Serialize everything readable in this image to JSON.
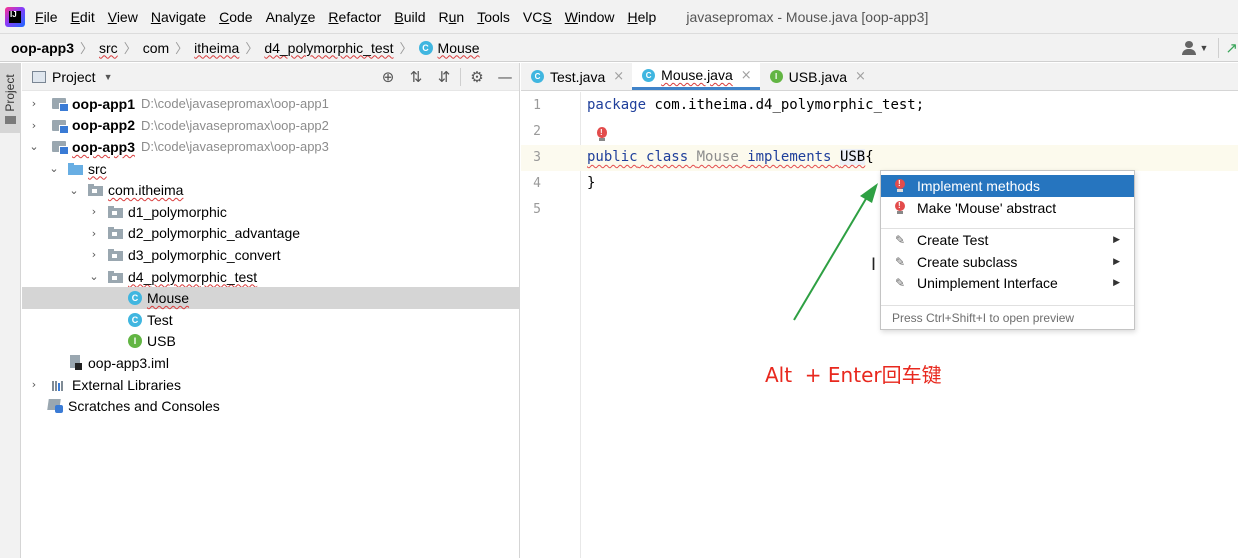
{
  "menu": {
    "items": [
      {
        "mnemonic": "F",
        "rest": "ile"
      },
      {
        "mnemonic": "E",
        "rest": "dit"
      },
      {
        "mnemonic": "V",
        "rest": "iew"
      },
      {
        "mnemonic": "N",
        "rest": "avigate"
      },
      {
        "mnemonic": "C",
        "rest": "ode"
      },
      {
        "pre": "Analy",
        "mnemonic": "z",
        "rest": "e"
      },
      {
        "mnemonic": "R",
        "rest": "efactor"
      },
      {
        "mnemonic": "B",
        "rest": "uild"
      },
      {
        "pre": "R",
        "mnemonic": "u",
        "rest": "n"
      },
      {
        "mnemonic": "T",
        "rest": "ools"
      },
      {
        "pre": "VC",
        "mnemonic": "S",
        "rest": ""
      },
      {
        "mnemonic": "W",
        "rest": "indow"
      },
      {
        "mnemonic": "H",
        "rest": "elp"
      }
    ],
    "window_title": "javasepromax - Mouse.java [oop-app3]"
  },
  "breadcrumb": {
    "project": "oop-app3",
    "src": "src",
    "com": "com",
    "itheima": "itheima",
    "package": "d4_polymorphic_test",
    "class_icon": "C",
    "class": "Mouse"
  },
  "project_panel": {
    "title": "Project"
  },
  "tree": {
    "app1_name": "oop-app1",
    "app1_path": "D:\\code\\javasepromax\\oop-app1",
    "app2_name": "oop-app2",
    "app2_path": "D:\\code\\javasepromax\\oop-app2",
    "app3_name": "oop-app3",
    "app3_path": "D:\\code\\javasepromax\\oop-app3",
    "src": "src",
    "com_itheima": "com.itheima",
    "d1": "d1_polymorphic",
    "d2": "d2_polymorphic_advantage",
    "d3": "d3_polymorphic_convert",
    "d4": "d4_polymorphic_test",
    "mouse": "Mouse",
    "test": "Test",
    "usb": "USB",
    "iml": "oop-app3.iml",
    "ext_libs": "External Libraries",
    "scratches": "Scratches and Consoles",
    "class_letter": "C",
    "iface_letter": "I"
  },
  "tabs": [
    {
      "label": "Test.java",
      "icon": "C"
    },
    {
      "label": "Mouse.java",
      "icon": "C"
    },
    {
      "label": "USB.java",
      "icon": "I"
    }
  ],
  "editor": {
    "line_numbers": [
      "1",
      "2",
      "3",
      "4",
      "5"
    ],
    "line1": {
      "kw": "package",
      "rest": " com.itheima.d4_polymorphic_test;"
    },
    "line3": {
      "kw1": "public",
      "kw2": "class",
      "name": "Mouse",
      "kw3": "implements",
      "iface": "USB",
      "brace": "{"
    },
    "line4": "}"
  },
  "popup": {
    "items": {
      "implement": "Implement methods",
      "abstract": "Make 'Mouse' abstract",
      "create_test": "Create Test",
      "create_subclass": "Create subclass",
      "unimplement": "Unimplement Interface"
    },
    "footer": "Press Ctrl+Shift+I to open preview"
  },
  "annotation": {
    "text": "Alt  + Enter回车键",
    "color": "#e8281e"
  },
  "colors": {
    "keyword": "#1f3f9b",
    "selection": "#2675bf",
    "arrow": "#2ea043"
  }
}
